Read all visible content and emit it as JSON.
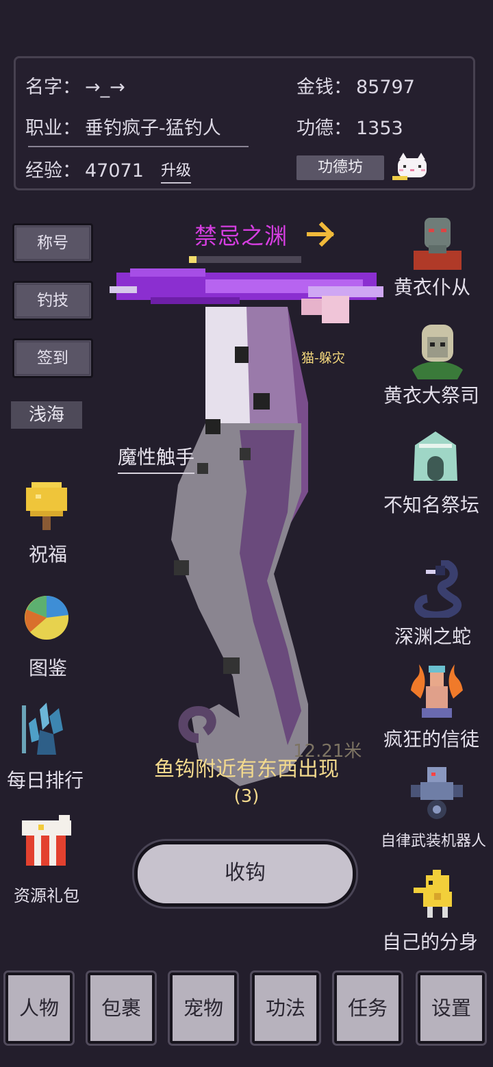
{
  "stats": {
    "name_label": "名字：",
    "name_value": "→_→",
    "job_label": "职业：",
    "job_value": "垂钓疯子-猛钓人",
    "exp_label": "经验：",
    "exp_value": "47071",
    "upgrade_label": "升级",
    "money_label": "金钱：",
    "money_value": "85797",
    "merit_label": "功德：",
    "merit_value": "1353",
    "merit_shop_label": "功德坊"
  },
  "left_menu": {
    "title_btn": "称号",
    "skill_btn": "钓技",
    "checkin_btn": "签到",
    "zone": "浅海"
  },
  "left_items": {
    "blessing": "祝福",
    "codex": "图鉴",
    "ranking": "每日排行",
    "gift": "资源礼包"
  },
  "center": {
    "area_title": "禁忌之渊",
    "catch_progress": 0.07,
    "buff_text": "猫-躲灾",
    "creature_label": "魔性触手",
    "distance": "12.21米",
    "notice": "鱼钩附近有东西出现",
    "countdown": "(3)",
    "reel_button": "收钩"
  },
  "right_items": {
    "r1": "黄衣仆从",
    "r2": "黄衣大祭司",
    "r3": "不知名祭坛",
    "r4": "深渊之蛇",
    "r5": "疯狂的信徒",
    "r6": "自律武装机器人",
    "r7": "自己的分身"
  },
  "tabs": [
    "人物",
    "包裹",
    "宠物",
    "功法",
    "任务",
    "设置"
  ],
  "colors": {
    "background": "#231e2c",
    "title": "#d53ee0",
    "notice": "#f2d98d",
    "arrow": "#f0b93a"
  }
}
